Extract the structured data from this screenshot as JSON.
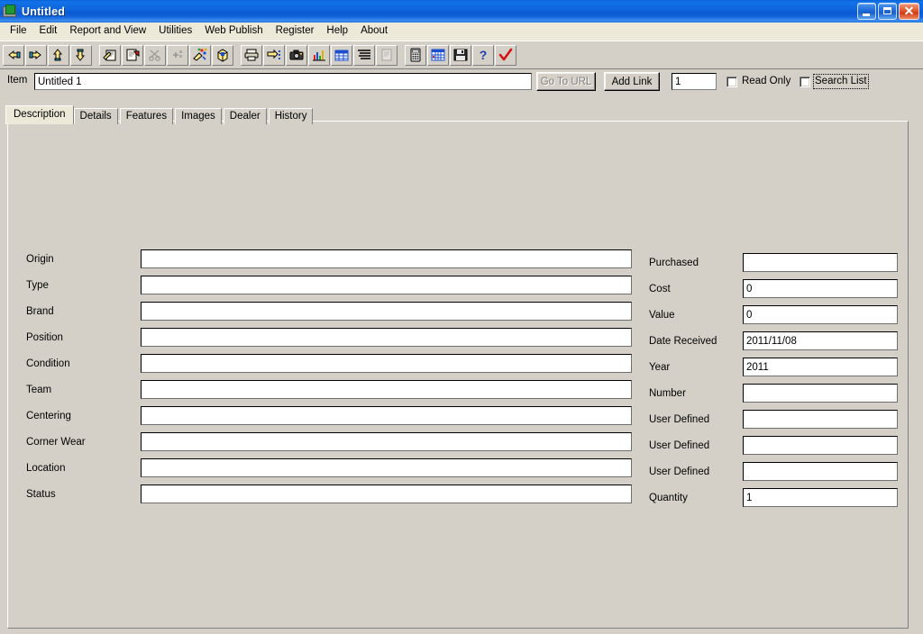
{
  "window": {
    "title": "Untitled",
    "icon": "application-icon",
    "buttons": {
      "minimize": "minimize-button",
      "maximize": "maximize-button",
      "close": "close-button"
    }
  },
  "menubar": {
    "items": [
      {
        "label": "File"
      },
      {
        "label": "Edit"
      },
      {
        "label": "Report and View"
      },
      {
        "label": "Utilities"
      },
      {
        "label": "Web Publish"
      },
      {
        "label": "Register"
      },
      {
        "label": "Help"
      },
      {
        "label": "About"
      }
    ]
  },
  "toolbar": {
    "buttons": [
      {
        "icon": "hand-first-icon",
        "enabled": true
      },
      {
        "icon": "hand-previous-icon",
        "enabled": true
      },
      {
        "icon": "hand-up-icon",
        "enabled": true
      },
      {
        "icon": "hand-down-icon",
        "enabled": true
      },
      {
        "icon": "edit-record-icon",
        "enabled": true
      },
      {
        "icon": "new-record-icon",
        "enabled": true
      },
      {
        "icon": "cut-record-icon",
        "enabled": false
      },
      {
        "icon": "add-rows-icon",
        "enabled": false
      },
      {
        "icon": "paint-icon",
        "enabled": true
      },
      {
        "icon": "package-icon",
        "enabled": true
      },
      {
        "icon": "print-icon",
        "enabled": true
      },
      {
        "icon": "print-preview-icon",
        "enabled": true
      },
      {
        "icon": "camera-icon",
        "enabled": true
      },
      {
        "icon": "chart-icon",
        "enabled": true
      },
      {
        "icon": "grid-icon",
        "enabled": true
      },
      {
        "icon": "list-icon",
        "enabled": true
      },
      {
        "icon": "report-icon",
        "enabled": false
      },
      {
        "icon": "calculator-icon",
        "enabled": true
      },
      {
        "icon": "calendar-icon",
        "enabled": true
      },
      {
        "icon": "save-icon",
        "enabled": true
      },
      {
        "icon": "help-icon",
        "enabled": true
      },
      {
        "icon": "checkmark-icon",
        "enabled": true
      }
    ]
  },
  "itembar": {
    "label": "Item",
    "item_value": "Untitled 1",
    "item_placeholder": "",
    "go_to_url_label": "Go To URL",
    "add_link_label": "Add Link",
    "quantity_value": "1",
    "read_only_label": "Read Only",
    "read_only_checked": false,
    "search_list_label": "Search List",
    "search_list_checked": false
  },
  "tabs": [
    {
      "label": "Description",
      "active": true
    },
    {
      "label": "Details",
      "active": false
    },
    {
      "label": "Features",
      "active": false
    },
    {
      "label": "Images",
      "active": false
    },
    {
      "label": "Dealer",
      "active": false
    },
    {
      "label": "History",
      "active": false
    }
  ],
  "form": {
    "left_fields": [
      {
        "label": "Origin",
        "value": ""
      },
      {
        "label": "Type",
        "value": ""
      },
      {
        "label": "Brand",
        "value": ""
      },
      {
        "label": "Position",
        "value": ""
      },
      {
        "label": "Condition",
        "value": ""
      },
      {
        "label": "Team",
        "value": ""
      },
      {
        "label": "Centering",
        "value": ""
      },
      {
        "label": "Corner Wear",
        "value": ""
      },
      {
        "label": "Location",
        "value": ""
      },
      {
        "label": "Status",
        "value": ""
      }
    ],
    "right_fields": [
      {
        "label": "Purchased",
        "value": ""
      },
      {
        "label": "Cost",
        "value": "0"
      },
      {
        "label": "Value",
        "value": "0"
      },
      {
        "label": "Date Received",
        "value": "2011/11/08"
      },
      {
        "label": "Year",
        "value": "2011"
      },
      {
        "label": "Number",
        "value": ""
      },
      {
        "label": "User Defined",
        "value": ""
      },
      {
        "label": "User Defined",
        "value": ""
      },
      {
        "label": "User Defined",
        "value": ""
      },
      {
        "label": "Quantity",
        "value": "1"
      }
    ]
  },
  "colors": {
    "titlebar_blue": "#0a5ad2",
    "menubar": "#ece9d8",
    "face": "#d4d0c8",
    "field_bg": "#ffffff",
    "disabled_text": "#808080"
  }
}
